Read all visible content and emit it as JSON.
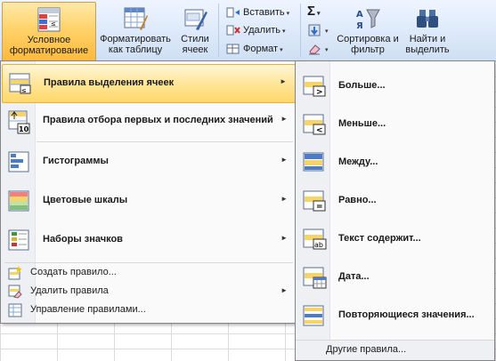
{
  "ribbon": {
    "conditional_formatting": "Условное форматирование",
    "format_as_table": "Форматировать как таблицу",
    "cell_styles": "Стили ячеек",
    "insert": "Вставить",
    "delete": "Удалить",
    "format": "Формат",
    "sort_filter": "Сортировка и фильтр",
    "find_select": "Найти и выделить",
    "autosum": "Σ"
  },
  "menu_main": {
    "items": [
      {
        "label": "Правила выделения ячеек",
        "icon": "highlight-cells-rules-icon",
        "submenu": true
      },
      {
        "label": "Правила отбора первых и последних значений",
        "icon": "top-bottom-rules-icon",
        "submenu": true
      },
      {
        "label": "Гистограммы",
        "icon": "data-bars-icon",
        "submenu": true
      },
      {
        "label": "Цветовые шкалы",
        "icon": "color-scales-icon",
        "submenu": true
      },
      {
        "label": "Наборы значков",
        "icon": "icon-sets-icon",
        "submenu": true
      }
    ],
    "small_items": [
      {
        "label": "Создать правило...",
        "icon": "new-rule-icon",
        "submenu": false
      },
      {
        "label": "Удалить правила",
        "icon": "clear-rules-icon",
        "submenu": true
      },
      {
        "label": "Управление правилами...",
        "icon": "manage-rules-icon",
        "submenu": false
      }
    ]
  },
  "menu_sub": {
    "items": [
      {
        "label": "Больше...",
        "icon": "greater-than-icon"
      },
      {
        "label": "Меньше...",
        "icon": "less-than-icon"
      },
      {
        "label": "Между...",
        "icon": "between-icon"
      },
      {
        "label": "Равно...",
        "icon": "equal-to-icon"
      },
      {
        "label": "Текст содержит...",
        "icon": "text-contains-icon"
      },
      {
        "label": "Дата...",
        "icon": "date-occurring-icon"
      },
      {
        "label": "Повторяющиеся значения...",
        "icon": "duplicate-values-icon"
      }
    ],
    "footer": "Другие правила..."
  },
  "submenu_glyph": "►",
  "dropdown_glyph": "▾"
}
